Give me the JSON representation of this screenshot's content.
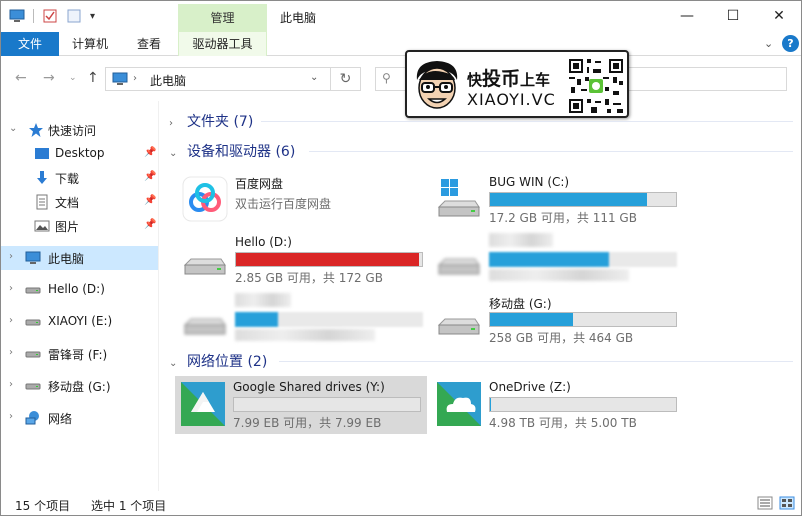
{
  "window": {
    "title": "此电脑",
    "manage_tab": "管理",
    "drive_tools_tab": "驱动器工具",
    "minimize_symbol": "—",
    "maximize_symbol": "☐",
    "close_symbol": "✕"
  },
  "ribbon": {
    "file": "文件",
    "computer": "计算机",
    "view": "查看",
    "help": "?"
  },
  "address": {
    "path": "此电脑",
    "refresh_symbol": "↻"
  },
  "watermark": {
    "cn_part1": "快",
    "cn_part2": "投币",
    "cn_part3": "上车",
    "domain": "XIAOYI.VC"
  },
  "sidebar": {
    "items": [
      {
        "label": "快速访问",
        "icon": "star-icon"
      },
      {
        "label": "Desktop",
        "icon": "desktop-icon"
      },
      {
        "label": "下载",
        "icon": "download-icon"
      },
      {
        "label": "文档",
        "icon": "document-icon"
      },
      {
        "label": "图片",
        "icon": "picture-icon"
      },
      {
        "label": "此电脑",
        "icon": "computer-icon"
      },
      {
        "label": "Hello (D:)",
        "icon": "drive-icon"
      },
      {
        "label": "XIAOYI (E:)",
        "icon": "drive-icon"
      },
      {
        "label": "雷锋哥 (F:)",
        "icon": "drive-icon"
      },
      {
        "label": "移动盘 (G:)",
        "icon": "drive-icon"
      },
      {
        "label": "网络",
        "icon": "network-icon"
      }
    ]
  },
  "groups": {
    "folders": "文件夹 (7)",
    "devices": "设备和驱动器 (6)",
    "network": "网络位置 (2)"
  },
  "drives": {
    "baidu": {
      "name": "百度网盘",
      "sub": "双击运行百度网盘"
    },
    "c": {
      "name": "BUG WIN (C:)",
      "sub": "17.2 GB 可用，共 111 GB",
      "used_fraction": 0.845
    },
    "d": {
      "name": "Hello (D:)",
      "sub": "2.85 GB 可用，共 172 GB",
      "used_fraction": 0.983
    },
    "e_blur": {
      "used_fraction": 0.64
    },
    "f_blur": {
      "used_fraction": 0.23
    },
    "g": {
      "name": "移动盘 (G:)",
      "sub": "258 GB 可用，共 464 GB",
      "used_fraction": 0.444
    },
    "y": {
      "name": "Google Shared drives (Y:)",
      "sub": "7.99 EB 可用，共 7.99 EB",
      "used_fraction": 0.0
    },
    "z": {
      "name": "OneDrive (Z:)",
      "sub": "4.98 TB 可用，共 5.00 TB",
      "used_fraction": 0.004
    }
  },
  "status": {
    "items": "15 个项目",
    "selected": "选中 1 个项目"
  },
  "colors": {
    "accent": "#1979ca",
    "bar_fill": "#26a0da",
    "bar_full": "#da2626",
    "group_header": "#1e3287",
    "selection": "#cce8ff"
  }
}
